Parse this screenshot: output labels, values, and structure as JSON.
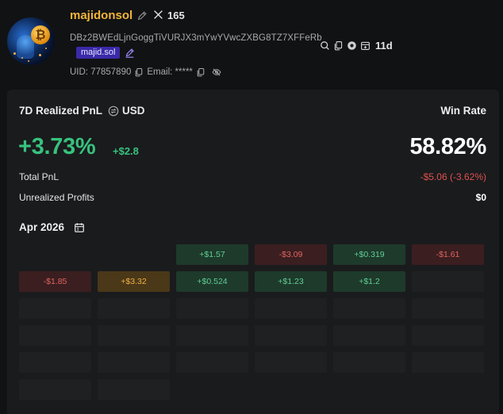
{
  "profile": {
    "name": "majidonsol",
    "x_followers": "165",
    "address": "DBz2BWEdLjnGoggTiVURJX3mYwYVwcZXBG8TZ7XFFeRb",
    "age": "11d",
    "domain": "majid.sol",
    "uid_label": "UID: 77857890",
    "email_label": "Email: *****",
    "colors": {
      "name": "#f2b53a",
      "badge": "#3a2aa8"
    }
  },
  "summary": {
    "title": "7D Realized PnL",
    "currency": "USD",
    "pnl_percent": "+3.73%",
    "pnl_usd": "+$2.8",
    "win_rate_label": "Win Rate",
    "win_rate": "58.82%",
    "total_pnl_label": "Total PnL",
    "total_pnl": "-$5.06 (-3.62%)",
    "unrealized_label": "Unrealized Profits",
    "unrealized": "$0",
    "colors": {
      "positive": "#37c27e",
      "negative": "#e0514d"
    }
  },
  "calendar": {
    "month": "Apr 2026",
    "cells": [
      {
        "label": "",
        "kind": "empty"
      },
      {
        "label": "",
        "kind": "empty"
      },
      {
        "label": "+$1.57",
        "kind": "pos"
      },
      {
        "label": "-$3.09",
        "kind": "neg"
      },
      {
        "label": "+$0.319",
        "kind": "pos"
      },
      {
        "label": "-$1.61",
        "kind": "neg"
      },
      {
        "label": "-$1.85",
        "kind": "neg"
      },
      {
        "label": "+$3.32",
        "kind": "hi"
      },
      {
        "label": "+$0.524",
        "kind": "pos"
      },
      {
        "label": "+$1.23",
        "kind": "pos"
      },
      {
        "label": "+$1.2",
        "kind": "pos"
      },
      {
        "label": "",
        "kind": "blank"
      },
      {
        "label": "",
        "kind": "blank"
      },
      {
        "label": "",
        "kind": "blank"
      },
      {
        "label": "",
        "kind": "blank"
      },
      {
        "label": "",
        "kind": "blank"
      },
      {
        "label": "",
        "kind": "blank"
      },
      {
        "label": "",
        "kind": "blank"
      },
      {
        "label": "",
        "kind": "blank"
      },
      {
        "label": "",
        "kind": "blank"
      },
      {
        "label": "",
        "kind": "blank"
      },
      {
        "label": "",
        "kind": "blank"
      },
      {
        "label": "",
        "kind": "blank"
      },
      {
        "label": "",
        "kind": "blank"
      },
      {
        "label": "",
        "kind": "blank"
      },
      {
        "label": "",
        "kind": "blank"
      },
      {
        "label": "",
        "kind": "blank"
      },
      {
        "label": "",
        "kind": "blank"
      },
      {
        "label": "",
        "kind": "blank"
      },
      {
        "label": "",
        "kind": "blank"
      },
      {
        "label": "",
        "kind": "blank"
      },
      {
        "label": "",
        "kind": "blank"
      }
    ]
  }
}
